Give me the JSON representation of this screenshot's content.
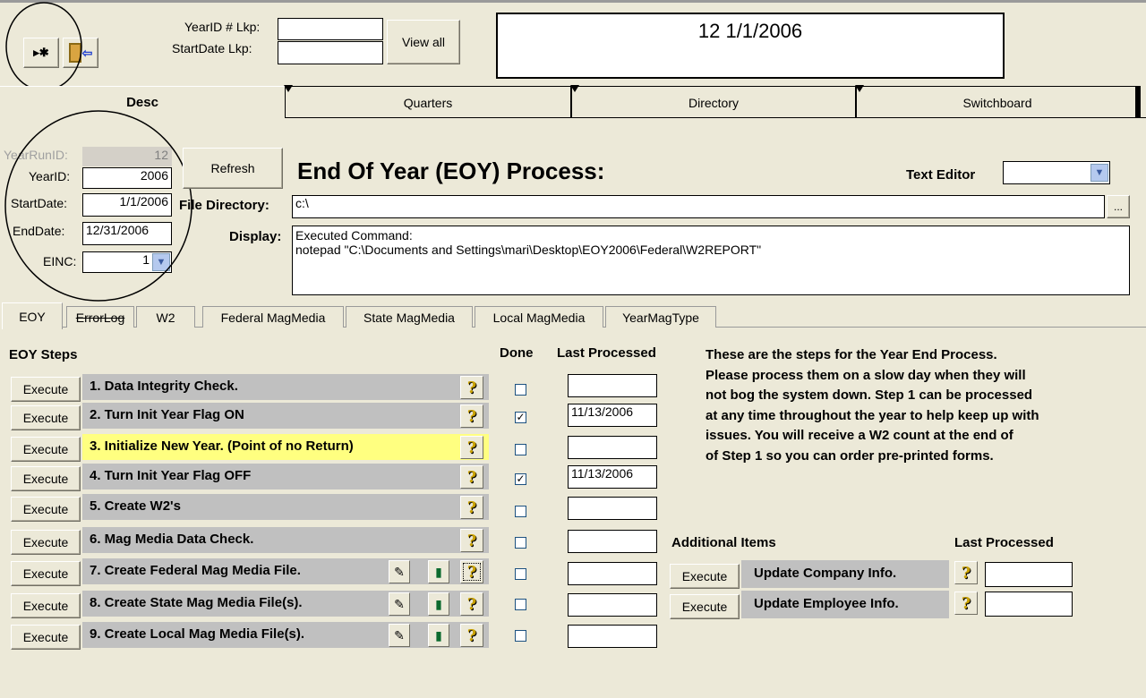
{
  "toolbar": {
    "new_record_glyph": "▸✱",
    "exit_glyph": "⇦",
    "yearid_lkp_label": "YearID # Lkp:",
    "startdate_lkp_label": "StartDate Lkp:",
    "yearid_lkp_value": "",
    "startdate_lkp_value": "",
    "view_all_label": "View all",
    "record_display": "12 1/1/2006"
  },
  "top_tabs": [
    "Desc",
    "Quarters",
    "Directory",
    "Switchboard"
  ],
  "header": {
    "yearrunid_label": "YearRunID:",
    "yearrunid_value": "12",
    "yearid_label": "YearID:",
    "yearid_value": "2006",
    "startdate_label": "StartDate:",
    "startdate_value": "1/1/2006",
    "enddate_label": "EndDate:",
    "enddate_value": "12/31/2006",
    "einc_label": "EINC:",
    "einc_value": "1",
    "refresh_label": "Refresh",
    "title": "End Of Year (EOY) Process:",
    "text_editor_label": "Text Editor",
    "text_editor_value": "",
    "file_directory_label": "File Directory:",
    "file_directory_value": "c:\\",
    "browse_label": "...",
    "display_label": "Display:",
    "display_line1": "Executed Command:",
    "display_line2": "notepad \"C:\\Documents and Settings\\mari\\Desktop\\EOY2006\\Federal\\W2REPORT\""
  },
  "sub_tabs": [
    "EOY",
    "ErrorLog",
    "W2",
    "Federal MagMedia",
    "State MagMedia",
    "Local MagMedia",
    "YearMagType"
  ],
  "eoy": {
    "steps_heading": "EOY Steps",
    "done_heading": "Done",
    "last_processed_heading": "Last Processed",
    "execute_label": "Execute",
    "help_glyph": "?",
    "steps": [
      {
        "label": "1. Data Integrity Check.",
        "done": "",
        "last": ""
      },
      {
        "label": "2. Turn Init Year Flag ON",
        "done": "✓",
        "last": "11/13/2006"
      },
      {
        "label": "3. Initialize New Year. (Point of no Return)",
        "done": "",
        "last": ""
      },
      {
        "label": "4. Turn Init Year Flag OFF",
        "done": "✓",
        "last": "11/13/2006"
      },
      {
        "label": "5. Create W2's",
        "done": "",
        "last": ""
      },
      {
        "label": "6. Mag Media Data Check.",
        "done": "",
        "last": ""
      },
      {
        "label": "7. Create Federal Mag Media File.",
        "done": "",
        "last": ""
      },
      {
        "label": "8. Create State Mag Media File(s).",
        "done": "",
        "last": ""
      },
      {
        "label": "9. Create Local Mag Media File(s).",
        "done": "",
        "last": ""
      }
    ],
    "edit_glyph": "✎",
    "disk_glyph": "▮",
    "info_lines": [
      "These are the steps for the Year End Process.",
      "Please process them on a slow day when they will",
      "not bog the system down.  Step 1 can be processed",
      "at any time throughout the year to help keep up with",
      "issues.  You will receive a W2 count at the end of",
      "of Step 1 so you can order pre-printed forms."
    ],
    "additional_heading": "Additional Items",
    "additional_last_heading": "Last Processed",
    "additional": [
      {
        "label": "Update Company Info.",
        "last": ""
      },
      {
        "label": "Update Employee Info.",
        "last": ""
      }
    ]
  }
}
